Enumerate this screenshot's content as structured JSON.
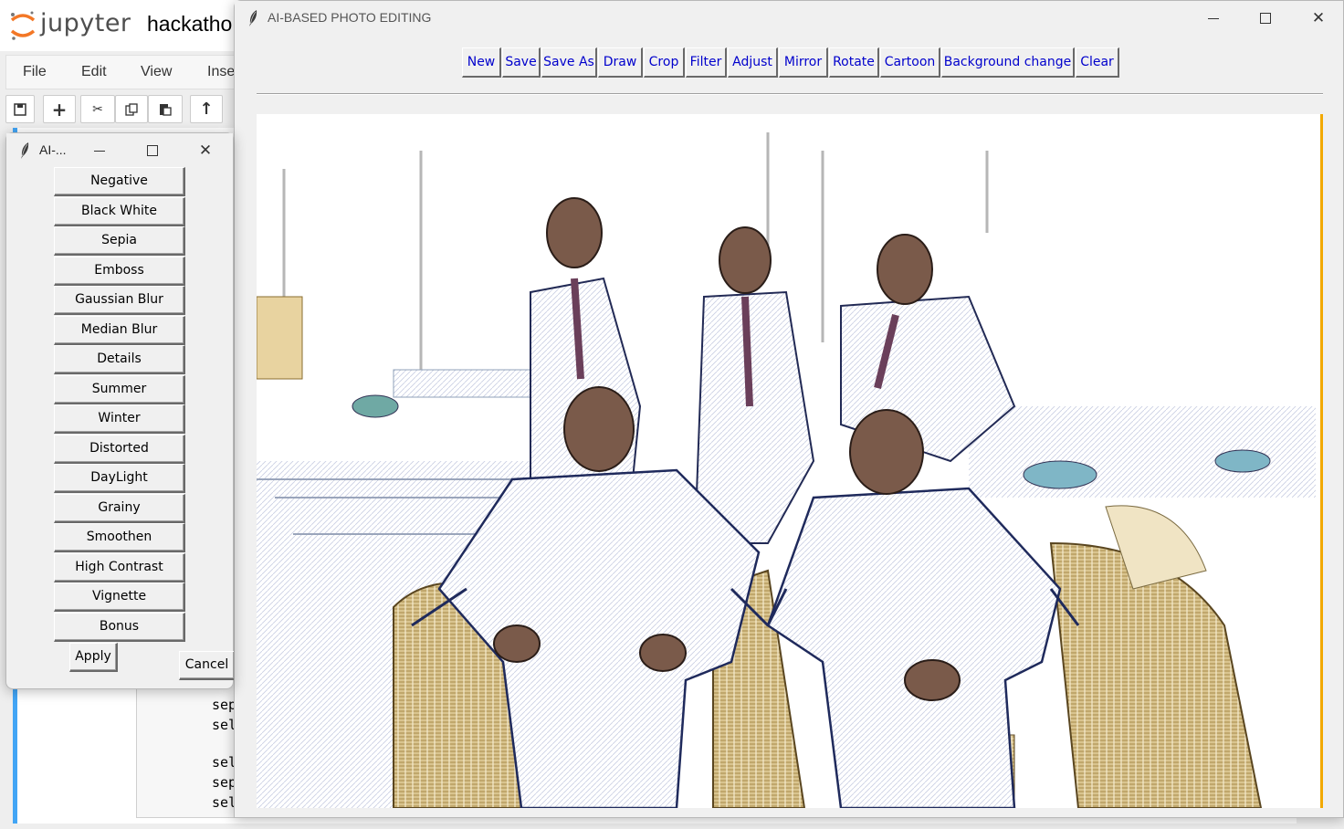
{
  "jupyter": {
    "brand": "jupyter",
    "notebook_name": "hackatho",
    "menu": [
      "File",
      "Edit",
      "View",
      "Inse"
    ],
    "code_lines": [
      "sep",
      "sel",
      "sel",
      "sep",
      "sel"
    ]
  },
  "editor": {
    "title": "AI-BASED PHOTO EDITING",
    "toolbar": [
      "New",
      "Save",
      "Save As",
      "Draw",
      "Crop",
      "Filter",
      "Adjust",
      "Mirror",
      "Rotate",
      "Cartoon",
      "Background change",
      "Clear"
    ],
    "accent_color": "#f2a900",
    "button_text_color": "#0000cc"
  },
  "filter_dialog": {
    "title": "AI-...",
    "filters": [
      "Negative",
      "Black White",
      "Sepia",
      "Emboss",
      "Gaussian Blur",
      "Median Blur",
      "Details",
      "Summer",
      "Winter",
      "Distorted",
      "DayLight",
      "Grainy",
      "Smoothen",
      "High Contrast",
      "Vignette",
      "Bonus"
    ],
    "apply_label": "Apply",
    "cancel_label": "Cancel"
  },
  "window_controls": {
    "minimize": "—",
    "maximize": "☐",
    "close": "✕"
  }
}
